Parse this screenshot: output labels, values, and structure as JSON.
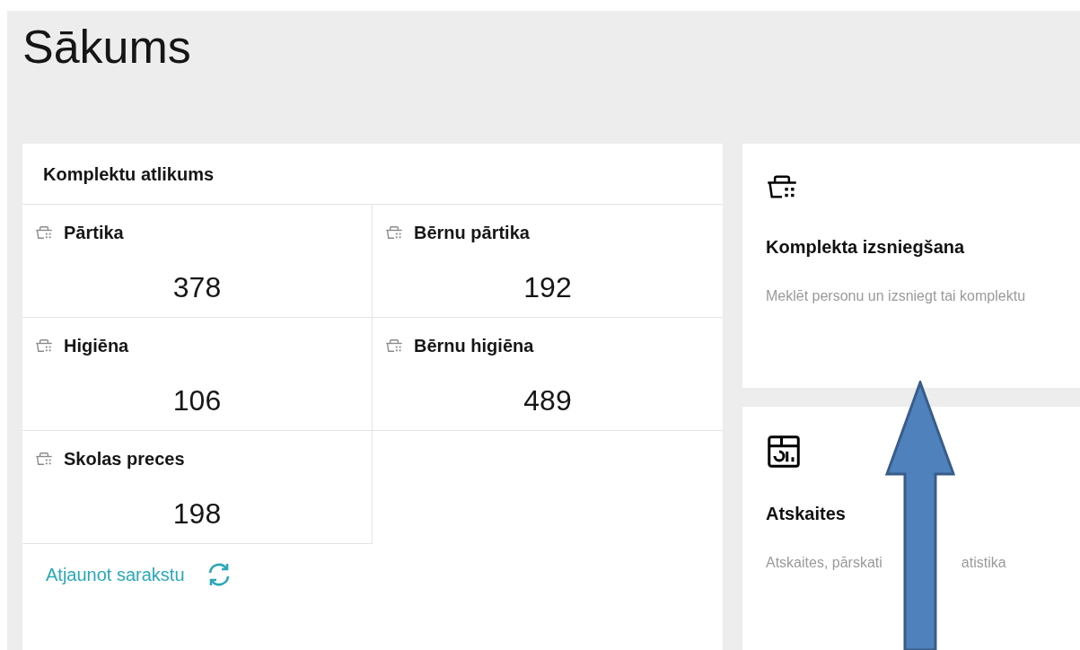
{
  "page": {
    "title": "Sākums"
  },
  "stock_panel": {
    "title": "Komplektu atlikums",
    "items": [
      {
        "label": "Pārtika",
        "count": "378"
      },
      {
        "label": "Bērnu pārtika",
        "count": "192"
      },
      {
        "label": "Higiēna",
        "count": "106"
      },
      {
        "label": "Bērnu higiēna",
        "count": "489"
      },
      {
        "label": "Skolas preces",
        "count": "198"
      }
    ],
    "refresh_link": "Atjaunot sarakstu"
  },
  "tiles": [
    {
      "kind": "basket",
      "title": "Komplekta izsniegšana",
      "description_parts": [
        "Meklēt personu un izsniegt tai komplektu"
      ]
    },
    {
      "kind": "report",
      "title": "Atskaites",
      "description_parts": [
        "Atskaites, pārskati",
        "atistika"
      ]
    }
  ]
}
